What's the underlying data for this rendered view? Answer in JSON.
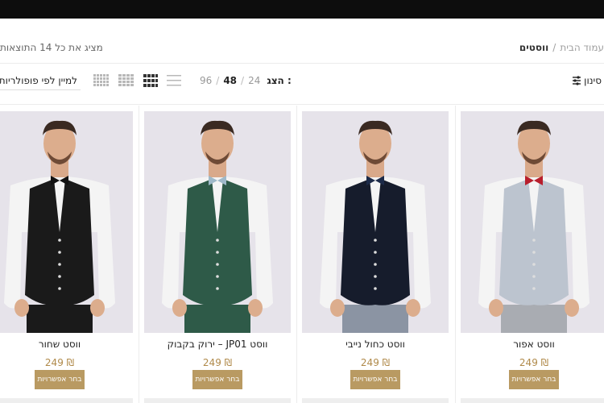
{
  "results_text": "מציג את כל 14 התוצאות",
  "breadcrumb": {
    "home": "עמוד הבית",
    "separator": "/",
    "current": "ווסטים"
  },
  "toolbar": {
    "sort_label": "למיין לפי פופולריות",
    "per_page_label": "הצג :",
    "per_page_options": [
      "24",
      "48",
      "96"
    ],
    "per_page_selected": "48",
    "per_page_separator": "/",
    "filter_label": "סינון",
    "view_icons": [
      "grid-4-icon",
      "grid-3-icon",
      "grid-2-icon",
      "list-view-icon"
    ]
  },
  "products": [
    {
      "name": "ווסט אפור",
      "price": "249 ₪",
      "button": "בחר אפשרויות",
      "vest_color": "#bcc4cf",
      "shirt_color": "#f4f4f4",
      "tie_color": "#b81e2c",
      "pants_color": "#a9acb2"
    },
    {
      "name": "ווסט כחול נייבי",
      "price": "249 ₪",
      "button": "בחר אפשרויות",
      "vest_color": "#161c2c",
      "shirt_color": "#f4f4f4",
      "tie_color": "#1c2a48",
      "pants_color": "#8b94a3"
    },
    {
      "name": "ווסט JP01 – ירוק בקבוק",
      "price": "249 ₪",
      "button": "בחר אפשרויות",
      "vest_color": "#2e5a48",
      "shirt_color": "#f4f4f4",
      "tie_color": "#9fb9c9",
      "pants_color": "#2e5a48"
    },
    {
      "name": "ווסט שחור",
      "price": "249 ₪",
      "button": "בחר אפשרויות",
      "vest_color": "#1a1a1a",
      "shirt_color": "#f4f4f4",
      "tie_color": "#111111",
      "pants_color": "#1a1a1a"
    }
  ],
  "colors": {
    "accent": "#b99a62",
    "price": "#b08a4a",
    "topbar": "#0d0d0d",
    "photo_bg": "#e6e3ea"
  }
}
